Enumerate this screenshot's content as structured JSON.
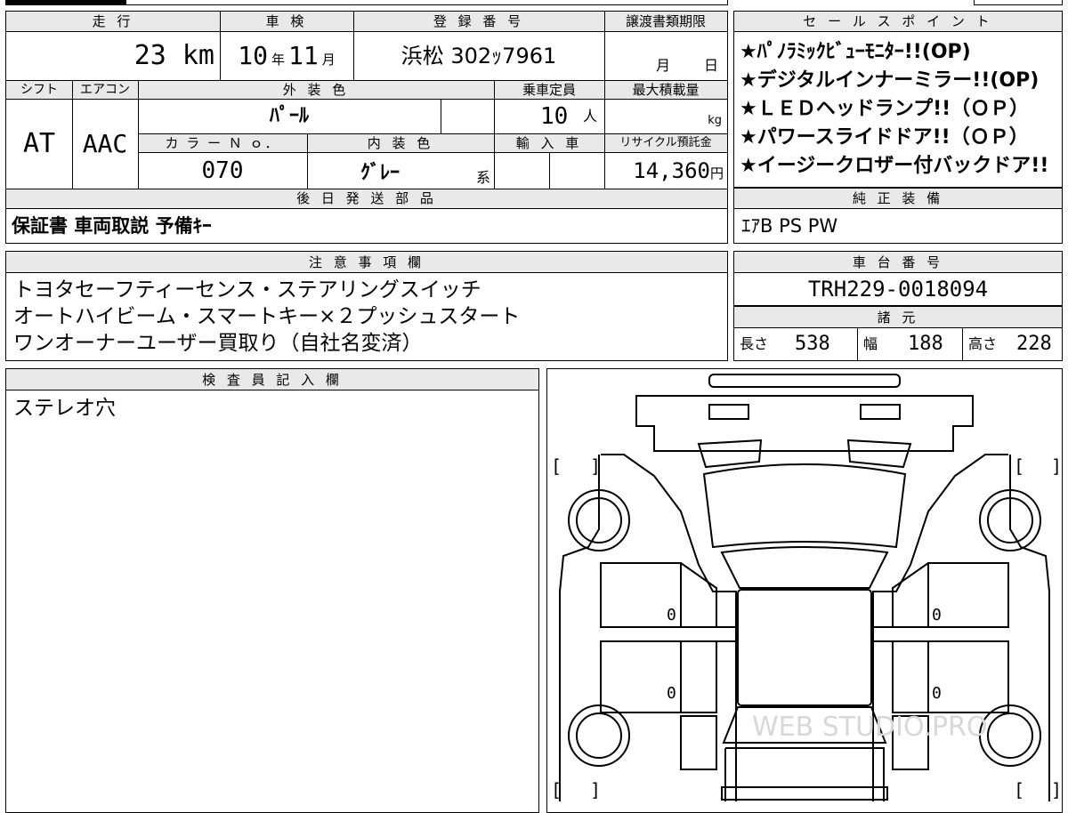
{
  "top_info": {
    "headers": {
      "mileage": "走 行",
      "inspection": "車 検",
      "registration": "登 録 番 号",
      "transfer_deadline": "譲渡書類期限",
      "shift": "シフト",
      "aircon": "エアコン",
      "exterior_color": "外 装 色",
      "capacity": "乗車定員",
      "max_load": "最大積載量",
      "color_no": "カ ラ ー Ｎ ｏ．",
      "interior_color": "内 装 色",
      "import": "輸 入 車",
      "recycle": "リサイクル預託金"
    },
    "mileage_value": "23",
    "mileage_unit": "km",
    "inspection_year": "10",
    "year_unit": "年",
    "inspection_month": "11",
    "month_unit": "月",
    "registration_number": "浜松 302ｯ7961",
    "transfer_month_unit": "月",
    "transfer_day_unit": "日",
    "shift_value": "AT",
    "aircon_value": "AAC",
    "exterior_color_value": "ﾊﾟｰﾙ",
    "capacity_value": "10",
    "capacity_unit": "人",
    "max_load_unit": "kg",
    "color_no_value": "070",
    "interior_color_value": "ｸﾞﾚｰ",
    "interior_suffix": "系",
    "recycle_value": "14,360",
    "recycle_unit": "円"
  },
  "later_parts": {
    "header": "後 日 発 送 部 品",
    "value": "保証書 車両取説 予備ｷｰ"
  },
  "sales_points": {
    "header": "セ ー ル ス ポ イ ン ト",
    "items": [
      "★ﾊﾟﾉﾗﾐｯｸﾋﾞｭｰﾓﾆﾀｰ!!(OP)",
      "★デジタルインナーミラー!!(OP)",
      "★ＬＥＤヘッドランプ!!（ＯＰ）",
      "★パワースライドドア!!（ＯＰ）",
      "★イージークロザー付バックドア!!"
    ]
  },
  "genuine_equipment": {
    "header": "純 正 装 備",
    "value": "ｴｱB PS PW"
  },
  "notes": {
    "header": "注 意 事 項 欄",
    "lines": [
      "トヨタセーフティーセンス・ステアリングスイッチ",
      "オートハイビーム・スマートキー×２プッシュスタート",
      "ワンオーナーユーザー買取り（自社名変済）"
    ]
  },
  "chassis": {
    "header": "車 台 番 号",
    "value": "TRH229-0018094"
  },
  "specs": {
    "header": "諸 元",
    "length_label": "長さ",
    "length_value": "538",
    "width_label": "幅",
    "width_value": "188",
    "height_label": "高さ",
    "height_value": "228"
  },
  "inspector": {
    "header": "検 査 員 記 入 欄",
    "text": "ステレオ穴"
  },
  "diagram": {
    "bracket_open": "[",
    "bracket_close": "]",
    "zero_marks": [
      "0",
      "0",
      "0",
      "0"
    ],
    "watermark": "WEB STUDIO.PRO"
  }
}
